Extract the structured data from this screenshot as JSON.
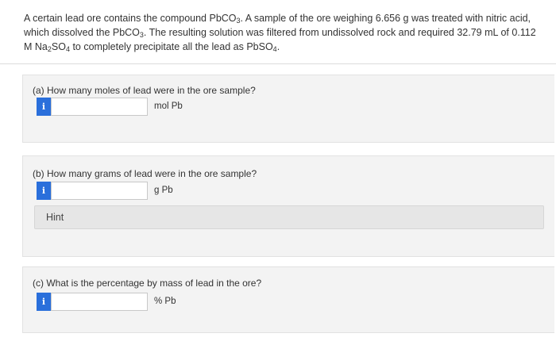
{
  "problem": {
    "p1": "A certain lead ore contains the compound PbCO",
    "p1_sub": "3",
    "p2": ". A sample of the ore weighing 6.656 g was treated with nitric acid, which dissolved the PbCO",
    "p2_sub": "3",
    "p3": ". The resulting solution was filtered from undissolved rock and required 32.79 mL of 0.112 M Na",
    "p3_sub": "2",
    "p4": "SO",
    "p4_sub": "4",
    "p5": " to completely precipitate all the lead as PbSO",
    "p5_sub": "4",
    "p6": "."
  },
  "parts": [
    {
      "question": "(a) How many moles of lead were in the ore sample?",
      "info_label": "i",
      "input_value": "",
      "unit": "mol Pb"
    },
    {
      "question": "(b) How many grams of lead were in the ore sample?",
      "info_label": "i",
      "input_value": "",
      "unit": "g Pb",
      "hint_label": "Hint"
    },
    {
      "question": "(c) What is the percentage by mass of lead in the ore?",
      "info_label": "i",
      "input_value": "",
      "unit": "% Pb"
    }
  ],
  "colors": {
    "info_button": "#2a6fdb",
    "section_background": "#f3f3f3",
    "hint_background": "#e6e6e6"
  }
}
